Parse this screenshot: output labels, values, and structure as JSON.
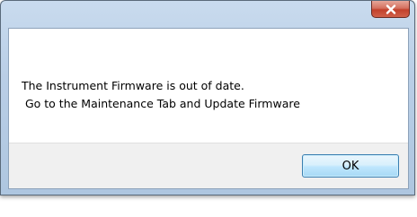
{
  "dialog": {
    "message_lines": [
      "The Instrument Firmware is out of date.",
      " Go to the Maintenance Tab and Update Firmware"
    ],
    "ok_label": "OK"
  },
  "icons": {
    "close": "close-icon"
  },
  "colors": {
    "close_button": "#c2412c",
    "ok_button_border": "#3c7fb1",
    "button_area_background": "#f0f0f0",
    "frame": "#b9cee6"
  }
}
